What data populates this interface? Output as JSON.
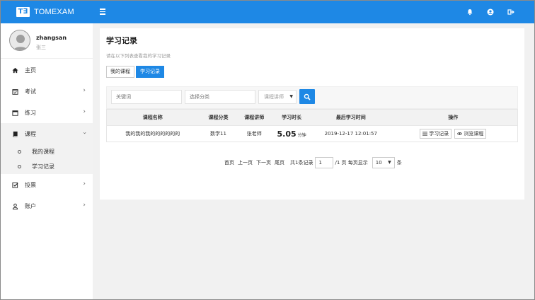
{
  "app": {
    "logo_mark": "T∃",
    "name": "TOMEXAM"
  },
  "user": {
    "username": "zhangsan",
    "realname": "张三"
  },
  "nav": {
    "home": "主页",
    "exam": "考试",
    "practice": "练习",
    "course": "课程",
    "course_sub": {
      "my_courses": "我的课程",
      "study_records": "学习记录"
    },
    "vote": "投票",
    "account": "账户"
  },
  "page": {
    "title": "学习记录",
    "description": "请在以下列表查看我的学习记录",
    "tabs": [
      {
        "label": "我的课程",
        "active": false
      },
      {
        "label": "学习记录",
        "active": true
      }
    ]
  },
  "filters": {
    "keyword_placeholder": "关键词",
    "category_placeholder": "选择分类",
    "teacher_select": "课程讲师"
  },
  "table": {
    "headers": [
      "课程名称",
      "课程分类",
      "课程讲师",
      "学习时长",
      "最后学习时间",
      "操作"
    ],
    "rows": [
      {
        "name": "我的我的我的的的的的的",
        "category": "数学11",
        "teacher": "张老师",
        "duration": "5.05",
        "duration_unit": "分钟",
        "last_time": "2019-12-17 12:01:57",
        "action_records": "学习记录",
        "action_browse": "浏览课程"
      }
    ]
  },
  "pagination": {
    "first": "首页",
    "prev": "上一页",
    "next": "下一页",
    "last": "尾页",
    "total": "共1条记录",
    "current_page": "1",
    "page_suffix": "/1 页 每页显示",
    "page_size": "10",
    "size_suffix": "条"
  },
  "colors": {
    "primary": "#1e88e5",
    "sidebar_bg": "#ffffff",
    "page_bg": "#f1f1f1"
  }
}
